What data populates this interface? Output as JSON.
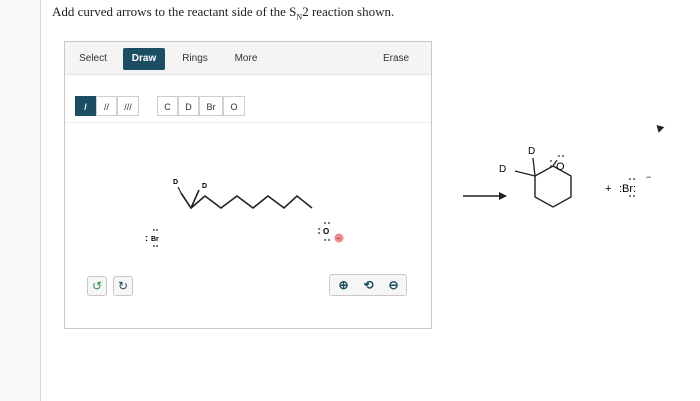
{
  "question": {
    "prefix": "Add curved arrows to the reactant side of the S",
    "subscript": "N",
    "suffix": "2 reaction shown."
  },
  "editor": {
    "tabs": [
      "Select",
      "Draw",
      "Rings",
      "More",
      "Erase"
    ],
    "active_tab": "Draw",
    "bond_tools": [
      "/",
      "//",
      "///"
    ],
    "atom_tools": [
      "C",
      "D",
      "Br",
      "O"
    ],
    "molecule_labels": {
      "d1": "D",
      "d2": "D",
      "br": "Br",
      "br_lone_pairs": ":",
      "oxygen": "O",
      "oxygen_charge": "−"
    },
    "undo_icon": "undo-icon",
    "redo_icon": "redo-icon",
    "zoom_icons": [
      "zoom-in-icon",
      "reset-zoom-icon",
      "zoom-out-icon"
    ]
  },
  "product": {
    "d_top": "D",
    "d_left": "D",
    "oxygen": "O",
    "plus": "+",
    "bromide": ":Br:",
    "bromide_charge": "−"
  },
  "colors": {
    "accent": "#1c4e63",
    "toolbar_bg": "#f4f4f4",
    "negative_charge": "#f28a8a"
  }
}
